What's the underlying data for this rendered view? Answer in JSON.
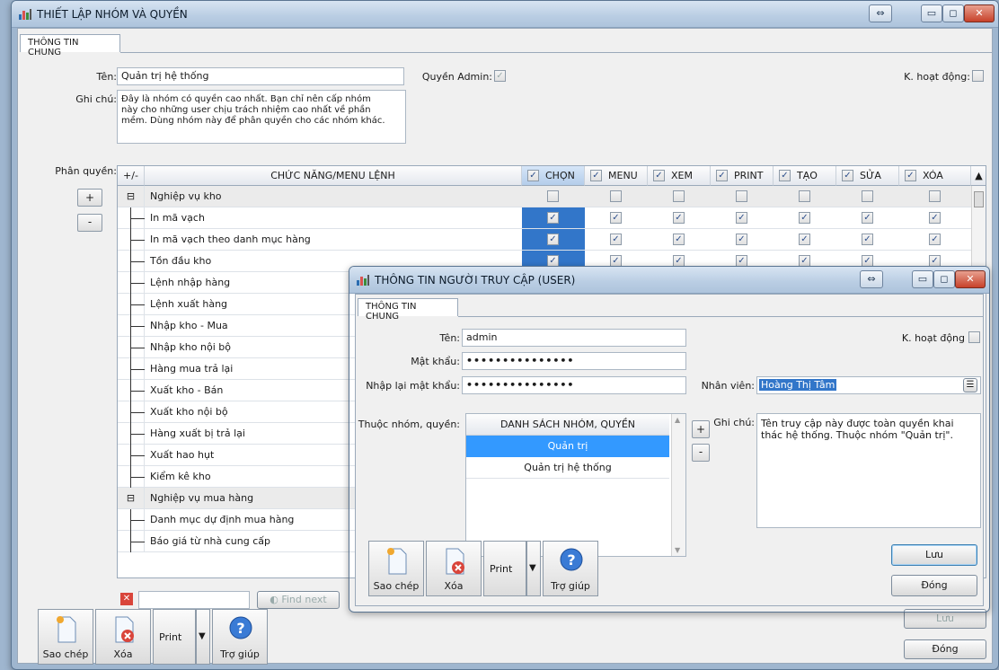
{
  "main_window": {
    "title": "THIẾT LẬP NHÓM VÀ QUYỀN",
    "tab": "THÔNG TIN CHUNG",
    "name_label": "Tên:",
    "name_value": "Quản trị hệ thống",
    "admin_label": "Quyền Admin:",
    "admin_checked": true,
    "inactive_label": "K. hoạt động:",
    "inactive_checked": false,
    "note_label": "Ghi chú:",
    "note_lines": [
      "Đây là nhóm có quyền cao nhất. Bạn chỉ nên cấp nhóm",
      "này cho những user chịu trách nhiệm cao nhất về phần",
      "mềm. Dùng nhóm này để phân quyền cho các nhóm khác."
    ],
    "perm_label": "Phân quyền:",
    "plus": "+",
    "minus": "-",
    "grid": {
      "col_toggle": "+/-",
      "col_function": "CHỨC NĂNG/MENU LỆNH",
      "perm_cols": [
        "CHỌN",
        "MENU",
        "XEM",
        "PRINT",
        "TẠO",
        "SỬA",
        "XÓA"
      ],
      "rows": [
        {
          "name": "Nghiệp vụ kho",
          "group": true,
          "expander": "⊟"
        },
        {
          "name": "In mã vạch",
          "group": false
        },
        {
          "name": "In mã vạch theo danh mục hàng",
          "group": false
        },
        {
          "name": "Tồn đầu kho",
          "group": false
        },
        {
          "name": "Lệnh nhập hàng",
          "group": false
        },
        {
          "name": "Lệnh xuất hàng",
          "group": false
        },
        {
          "name": "Nhập kho - Mua",
          "group": false
        },
        {
          "name": "Nhập kho nội bộ",
          "group": false
        },
        {
          "name": "Hàng mua trả lại",
          "group": false
        },
        {
          "name": "Xuất kho - Bán",
          "group": false
        },
        {
          "name": "Xuất kho nội bộ",
          "group": false
        },
        {
          "name": "Hàng xuất bị trả lại",
          "group": false
        },
        {
          "name": "Xuất hao hụt",
          "group": false
        },
        {
          "name": "Kiểm kê kho",
          "group": false
        },
        {
          "name": "Nghiệp vụ mua hàng",
          "group": true,
          "expander": "⊟"
        },
        {
          "name": "Danh mục dự định mua hàng",
          "group": false
        },
        {
          "name": "Báo giá từ nhà cung cấp",
          "group": false
        }
      ]
    },
    "find_next": "Find next",
    "buttons": {
      "copy": "Sao chép",
      "delete": "Xóa",
      "print": "Print",
      "help": "Trợ giúp",
      "save": "Lưu",
      "close": "Đóng"
    }
  },
  "user_dialog": {
    "title": "THÔNG TIN NGƯỜI TRUY CẬP (USER)",
    "tab": "THÔNG TIN CHUNG",
    "name_label": "Tên:",
    "name_value": "admin",
    "inactive_label": "K. hoạt động",
    "password_label": "Mật khẩu:",
    "password_value": "•••••••••••••••",
    "confirm_label": "Nhập lại mật khẩu:",
    "confirm_value": "•••••••••••••••",
    "employee_label": "Nhân viên:",
    "employee_value": "Hoàng Thị Tâm",
    "group_label": "Thuộc nhóm, quyền:",
    "group_list_header": "DANH SÁCH NHÓM, QUYỀN",
    "group_items": [
      "Quản trị",
      "Quản trị hệ thống"
    ],
    "note_label": "Ghi chú:",
    "note_lines": [
      "Tên truy cập này được toàn quyền khai",
      "thác hệ thống. Thuộc nhóm \"Quản trị\"."
    ],
    "buttons": {
      "copy": "Sao chép",
      "delete": "Xóa",
      "print": "Print",
      "help": "Trợ giúp",
      "save": "Lưu",
      "close": "Đóng"
    }
  },
  "colors": {
    "selection": "#3276c9",
    "title_gradient": "#b9cde3"
  }
}
